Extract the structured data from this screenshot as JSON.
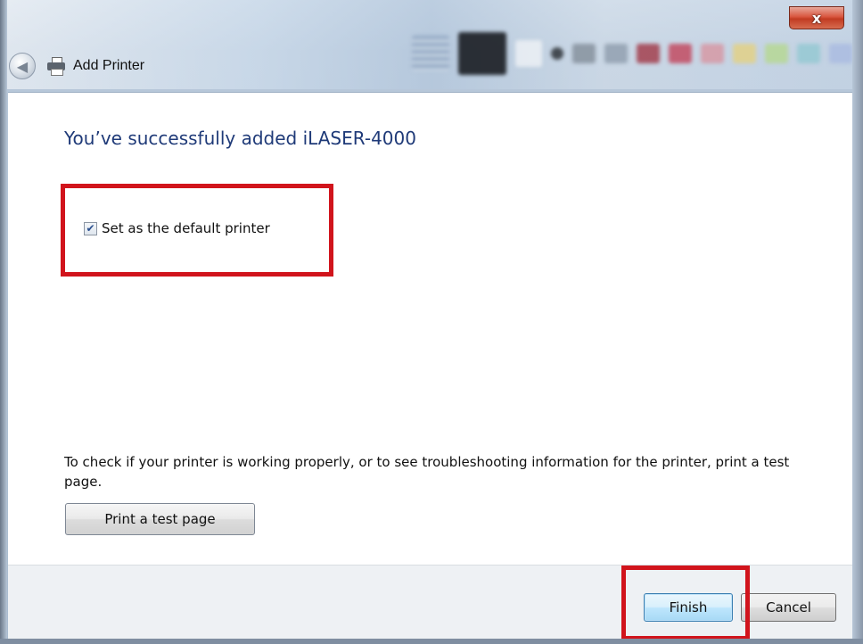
{
  "window": {
    "title": "Add Printer",
    "close_label": "x"
  },
  "icons": {
    "back": "back-arrow-icon",
    "printer": "printer-icon",
    "check": "checkmark-icon"
  },
  "content": {
    "heading": "You’ve successfully added iLASER-4000",
    "default_printer": {
      "label": "Set as the default printer",
      "checked": true
    },
    "info_text": "To check if your printer is working properly, or to see troubleshooting information for the printer, print a test page.",
    "test_button_label": "Print a test page"
  },
  "footer": {
    "finish_label": "Finish",
    "cancel_label": "Cancel"
  },
  "colors": {
    "heading": "#1f3a78",
    "highlight": "#d1141c",
    "close_button": "#c23b22"
  }
}
